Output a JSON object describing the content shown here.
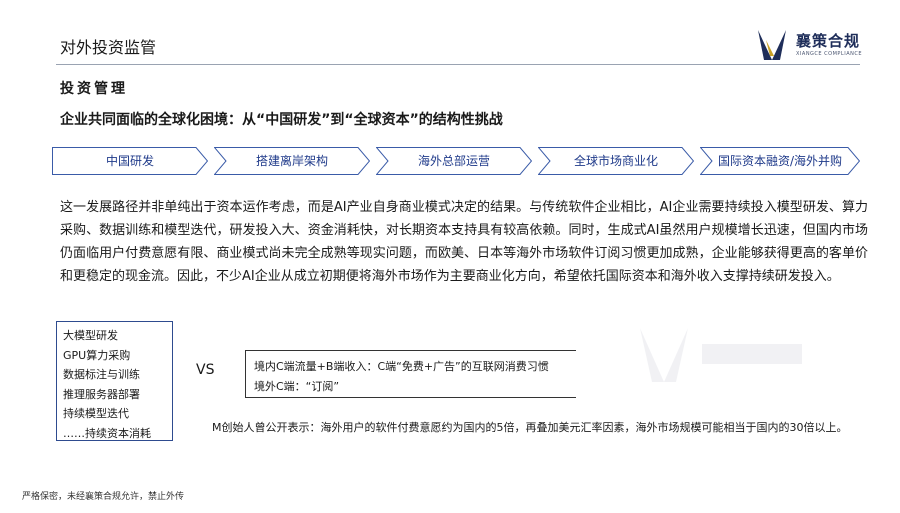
{
  "header": {
    "title": "对外投资监管",
    "logo_name": "襄策合规",
    "logo_sub": "XIANGCE COMPLIANCE",
    "brand_color": "#1f2e5a",
    "accent_color": "#c9a227"
  },
  "section_title": "投资管理",
  "main_heading": "企业共同面临的全球化困境：从“中国研发”到“全球资本”的结构性挑战",
  "flow": {
    "steps": [
      "中国研发",
      "搭建离岸架构",
      "海外总部运营",
      "全球市场商业化",
      "国际资本融资/海外并购"
    ],
    "stroke_color": "#3a5ba8"
  },
  "paragraph": "这一发展路径并非单纯出于资本运作考虑，而是AI产业自身商业模式决定的结果。与传统软件企业相比，AI企业需要持续投入模型研发、算力采购、数据训练和模型迭代，研发投入大、资金消耗快，对长期资本支持具有较高依赖。同时，生成式AI虽然用户规模增长迅速，但国内市场仍面临用户付费意愿有限、商业模式尚未完全成熟等现实问题，而欧美、日本等海外市场软件订阅习惯更加成熟，企业能够获得更高的客单价和更稳定的现金流。因此，不少AI企业从成立初期便将海外市场作为主要商业化方向，希望依托国际资本和海外收入支撑持续研发投入。",
  "cost_list": [
    "大模型研发",
    "GPU算力采购",
    "数据标注与训练",
    "推理服务器部署",
    "持续模型迭代",
    "……持续资本消耗"
  ],
  "vs_label": "VS",
  "revenue": {
    "line1": "境内C端流量+B端收入：C端“免费+广告”的互联网消费习惯",
    "line2": "境外C端：“订阅”"
  },
  "quote": "M创始人曾公开表示：海外用户的软件付费意愿约为国内的5倍，再叠加美元汇率因素，海外市场规模可能相当于国内的30倍以上。",
  "footer": "严格保密，未经襄策合规允许，禁止外传"
}
